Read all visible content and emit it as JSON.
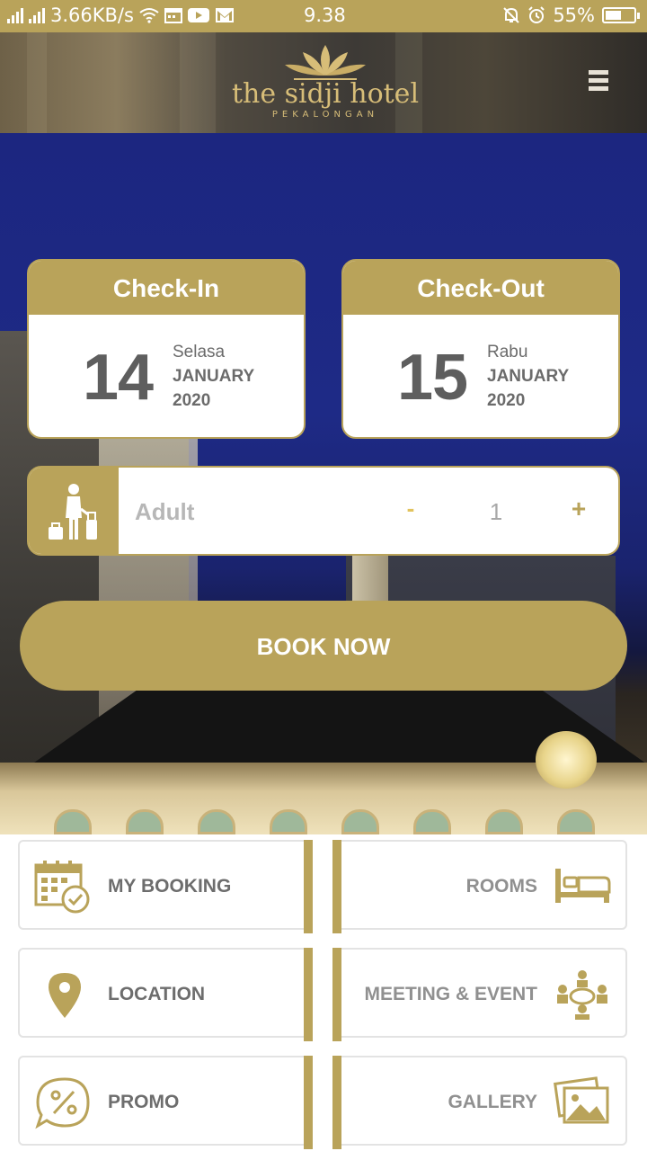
{
  "status_bar": {
    "speed": "3.66KB/s",
    "time": "9.38",
    "battery": "55%",
    "battery_level": 0.55
  },
  "header": {
    "logo_name": "the sidji hotel",
    "logo_sub": "PEKALONGAN"
  },
  "checkin": {
    "title": "Check-In",
    "day": "14",
    "weekday": "Selasa",
    "month": "JANUARY",
    "year": "2020"
  },
  "checkout": {
    "title": "Check-Out",
    "day": "15",
    "weekday": "Rabu",
    "month": "JANUARY",
    "year": "2020"
  },
  "guests": {
    "label": "Adult",
    "minus": "-",
    "count": "1",
    "plus": "+"
  },
  "book_label": "BOOK NOW",
  "menu": {
    "my_booking": "MY BOOKING",
    "rooms": "ROOMS",
    "location": "LOCATION",
    "meeting_event": "MEETING & EVENT",
    "promo": "PROMO",
    "gallery": "GALLERY"
  },
  "colors": {
    "accent_gold": "#b9a35a",
    "hero_blue": "#1e2a86"
  }
}
